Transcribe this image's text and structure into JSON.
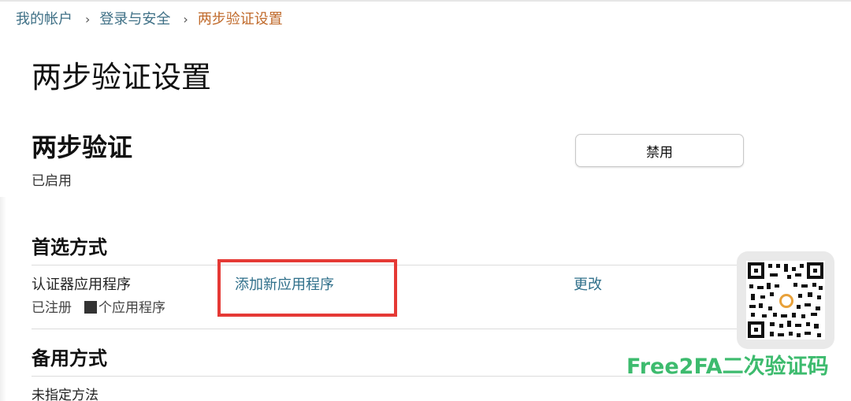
{
  "breadcrumb": {
    "items": [
      "我的帐户",
      "登录与安全"
    ],
    "current": "两步验证设置",
    "separator": "›"
  },
  "page": {
    "title": "两步验证设置"
  },
  "two_step": {
    "heading": "两步验证",
    "status": "已启用",
    "disable_label": "禁用"
  },
  "preferred": {
    "heading": "首选方式",
    "method_name": "认证器应用程序",
    "detail_prefix": "已注册",
    "detail_suffix": "个应用程序",
    "add_app_label": "添加新应用程序",
    "change_label": "更改"
  },
  "backup": {
    "heading": "备用方式",
    "method_text": "未指定方法"
  },
  "watermark": {
    "brand": "Free2FA二次验证码",
    "brand_color": "#3dbb6e"
  },
  "colors": {
    "link": "#2f6f8a",
    "breadcrumb_current": "#c06a2b",
    "highlight": "#e53935"
  }
}
